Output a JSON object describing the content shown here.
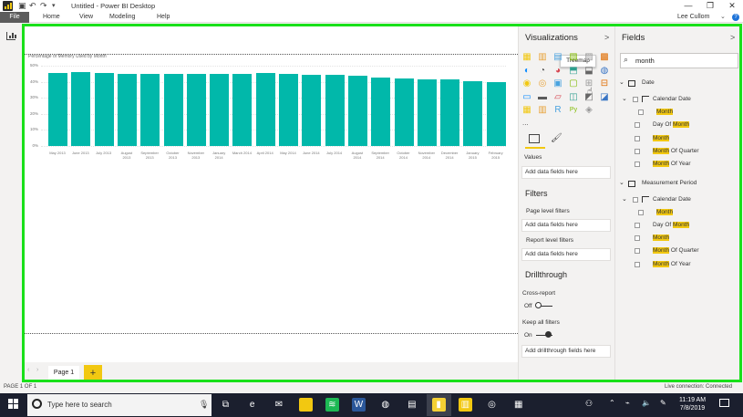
{
  "window": {
    "title": "Untitled - Power BI Desktop",
    "user": "Lee Cullom",
    "help": "?"
  },
  "ribbon": {
    "file": "File",
    "tabs": [
      "Home",
      "View",
      "Modeling",
      "Help"
    ]
  },
  "chart_data": {
    "type": "bar",
    "title": "Percentage of Memory Used by Month",
    "categories": [
      "May 2013",
      "June 2013",
      "July 2013",
      "August 2013",
      "September 2013",
      "October 2013",
      "November 2013",
      "January 2014",
      "March 2014",
      "April 2014",
      "May 2014",
      "June 2014",
      "July 2014",
      "August 2014",
      "September 2014",
      "October 2014",
      "November 2014",
      "December 2014",
      "January 2015",
      "February 2015"
    ],
    "values": [
      45.3,
      45.8,
      45.6,
      44.9,
      45.0,
      44.8,
      45.1,
      44.9,
      45.0,
      45.2,
      45.1,
      44.3,
      44.4,
      43.8,
      42.5,
      42.0,
      41.7,
      41.5,
      40.3,
      39.8
    ],
    "yticks": [
      "50%",
      "40%",
      "30%",
      "20%",
      "10%",
      "0%"
    ],
    "ylim": [
      0,
      50
    ]
  },
  "pages": {
    "current": "Page 1",
    "add": "+"
  },
  "viz": {
    "title": "Visualizations",
    "tooltip": "Treemap",
    "values_label": "Values",
    "add_fields": "Add data fields here",
    "filters_title": "Filters",
    "page_filters": "Page level filters",
    "report_filters": "Report level filters",
    "drill_title": "Drillthrough",
    "cross_report": "Cross-report",
    "cross_state": "Off",
    "keep_filters": "Keep all filters",
    "keep_state": "On",
    "drill_fields": "Add drillthrough fields here",
    "more": "...",
    "chevron": ">"
  },
  "fields": {
    "title": "Fields",
    "chevron": ">",
    "search_value": "month",
    "tables": [
      {
        "name": "Date",
        "group": "Calendar Date",
        "items": [
          {
            "pre": "",
            "hl": "Month",
            "post": ""
          },
          {
            "pre": "Day Of ",
            "hl": "Month",
            "post": ""
          },
          {
            "pre": "",
            "hl": "Month",
            "post": ""
          },
          {
            "pre": "",
            "hl": "Month",
            "post": " Of Quarter"
          },
          {
            "pre": "",
            "hl": "Month",
            "post": " Of Year"
          }
        ]
      },
      {
        "name": "Measurement Period",
        "group": "Calendar Date",
        "items": [
          {
            "pre": "",
            "hl": "Month",
            "post": ""
          },
          {
            "pre": "Day Of ",
            "hl": "Month",
            "post": ""
          },
          {
            "pre": "",
            "hl": "Month",
            "post": ""
          },
          {
            "pre": "",
            "hl": "Month",
            "post": " Of Quarter"
          },
          {
            "pre": "",
            "hl": "Month",
            "post": " Of Year"
          }
        ]
      }
    ]
  },
  "status": {
    "left": "PAGE 1 OF 1",
    "right": "Live connection: Connected"
  },
  "taskbar": {
    "search": "Type here to search",
    "time": "11:19 AM",
    "date": "7/8/2019"
  },
  "colors": {
    "bar": "#01b8aa",
    "highlight": "#f2c811",
    "border": "#19e01a"
  }
}
